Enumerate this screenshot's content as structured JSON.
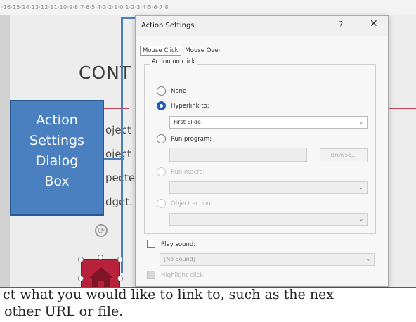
{
  "ruler": {
    "ticks": "·16·15·14·13·12·11·10·9·8·7·6·5·4·3·2·1·0·1·2·3·4·5·6·7·8"
  },
  "slide": {
    "title": "CONT",
    "bullets": [
      "oject",
      "oject",
      "pecte",
      "dget."
    ],
    "callout_lines": [
      "Action",
      "Settings",
      "Dialog",
      "Box"
    ]
  },
  "dialog": {
    "title": "Action Settings",
    "help": "?",
    "close": "✕",
    "tabs": [
      "Mouse Click",
      "Mouse Over"
    ],
    "group_label": "Action on click",
    "options": {
      "none": "None",
      "hyperlink": "Hyperlink to:",
      "hyperlink_value": "First Slide",
      "run_program": "Run program:",
      "browse": "Browse...",
      "run_macro": "Run macro:",
      "object_action": "Object action:"
    },
    "play_sound": "Play sound:",
    "sound_value": "[No Sound]",
    "highlight": "Highlight click"
  },
  "caption": {
    "line1": "ct what you would like to link to, such as the nex",
    "line2": "other URL or file."
  },
  "colors": {
    "accent": "#4a7fc0",
    "brand_red": "#b8213a",
    "radio_checked": "#1b5fb6"
  }
}
